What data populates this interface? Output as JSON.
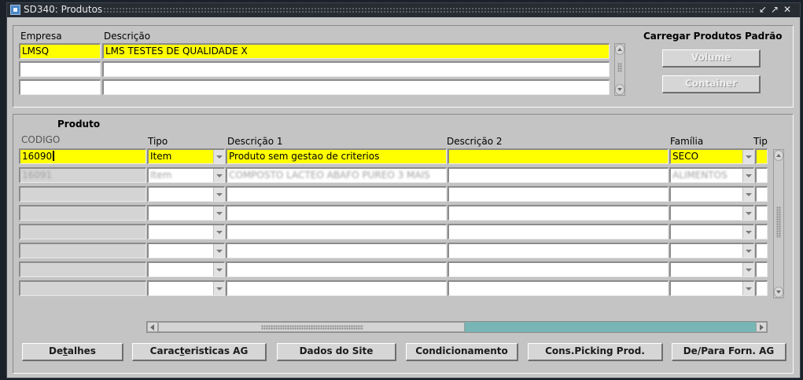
{
  "window": {
    "title": "SD340: Produtos"
  },
  "empresa_block": {
    "labels": {
      "empresa": "Empresa",
      "descricao": "Descrição"
    },
    "rows": [
      {
        "empresa": "LMSQ",
        "descricao": "LMS TESTES DE QUALIDADE X"
      },
      {
        "empresa": "",
        "descricao": ""
      },
      {
        "empresa": "",
        "descricao": ""
      }
    ]
  },
  "carregar": {
    "title": "Carregar Produtos Padrão",
    "volume_label": "Volume",
    "container_label": "Container"
  },
  "produto_block": {
    "title": "Produto",
    "columns": {
      "codigo": "CODIGO",
      "tipo": "Tipo",
      "descricao1": "Descrição 1",
      "descricao2": "Descrição 2",
      "familia": "Família",
      "tipo2": "Tip"
    },
    "rows": [
      {
        "codigo": "16090",
        "tipo": "Item",
        "descricao1": "Produto sem gestao de criterios",
        "descricao2": "",
        "familia": "SECO"
      },
      {
        "codigo": "16091",
        "tipo": "Item",
        "descricao1": "COMPOSTO LACTEO ABAFO PUREO 3 MAIS",
        "descricao2": "",
        "familia": "ALIMENTOS"
      },
      {
        "codigo": "",
        "tipo": "",
        "descricao1": "",
        "descricao2": "",
        "familia": ""
      },
      {
        "codigo": "",
        "tipo": "",
        "descricao1": "",
        "descricao2": "",
        "familia": ""
      },
      {
        "codigo": "",
        "tipo": "",
        "descricao1": "",
        "descricao2": "",
        "familia": ""
      },
      {
        "codigo": "",
        "tipo": "",
        "descricao1": "",
        "descricao2": "",
        "familia": ""
      },
      {
        "codigo": "",
        "tipo": "",
        "descricao1": "",
        "descricao2": "",
        "familia": ""
      },
      {
        "codigo": "",
        "tipo": "",
        "descricao1": "",
        "descricao2": "",
        "familia": ""
      }
    ]
  },
  "buttons": {
    "detalhes_pre": "De",
    "detalhes_mn": "t",
    "detalhes_post": "alhes",
    "caract_pre": "Carac",
    "caract_mn": "t",
    "caract_post": "eristicas AG",
    "dados_site": "Dados do Site",
    "condicionamento": "Condicionamento",
    "cons_picking": "Cons.Picking Prod.",
    "depara": "De/Para Forn. AG"
  },
  "icons": [
    "app-icon",
    "minimize-icon",
    "restore-icon",
    "close-icon",
    "scroll-up-icon",
    "scroll-down-icon",
    "scroll-left-icon",
    "scroll-right-icon",
    "dropdown-arrow-icon"
  ],
  "colors": {
    "current_record": "#ffff00",
    "titlebar": "#272c33",
    "canvas": "#c4c4c4",
    "hscroll_track": "#78b5b5"
  }
}
